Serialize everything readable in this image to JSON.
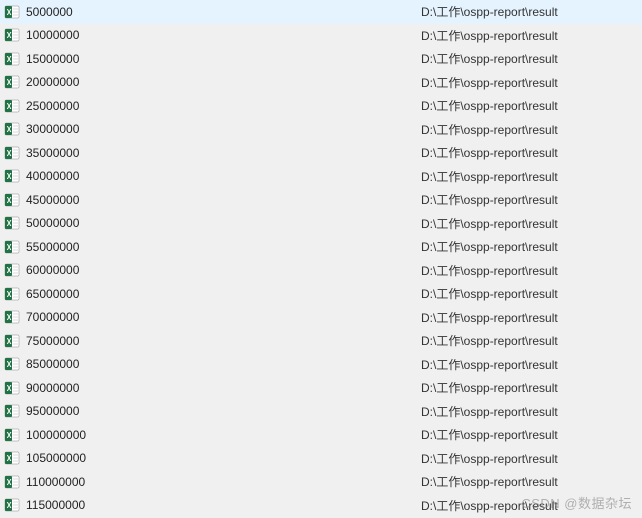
{
  "watermark": "CSDN @数据杂坛",
  "common_path": "D:\\工作\\ospp-report\\result",
  "files": [
    {
      "name": "5000000"
    },
    {
      "name": "10000000"
    },
    {
      "name": "15000000"
    },
    {
      "name": "20000000"
    },
    {
      "name": "25000000"
    },
    {
      "name": "30000000"
    },
    {
      "name": "35000000"
    },
    {
      "name": "40000000"
    },
    {
      "name": "45000000"
    },
    {
      "name": "50000000"
    },
    {
      "name": "55000000"
    },
    {
      "name": "60000000"
    },
    {
      "name": "65000000"
    },
    {
      "name": "70000000"
    },
    {
      "name": "75000000"
    },
    {
      "name": "85000000"
    },
    {
      "name": "90000000"
    },
    {
      "name": "95000000"
    },
    {
      "name": "100000000"
    },
    {
      "name": "105000000"
    },
    {
      "name": "110000000"
    },
    {
      "name": "115000000"
    }
  ]
}
